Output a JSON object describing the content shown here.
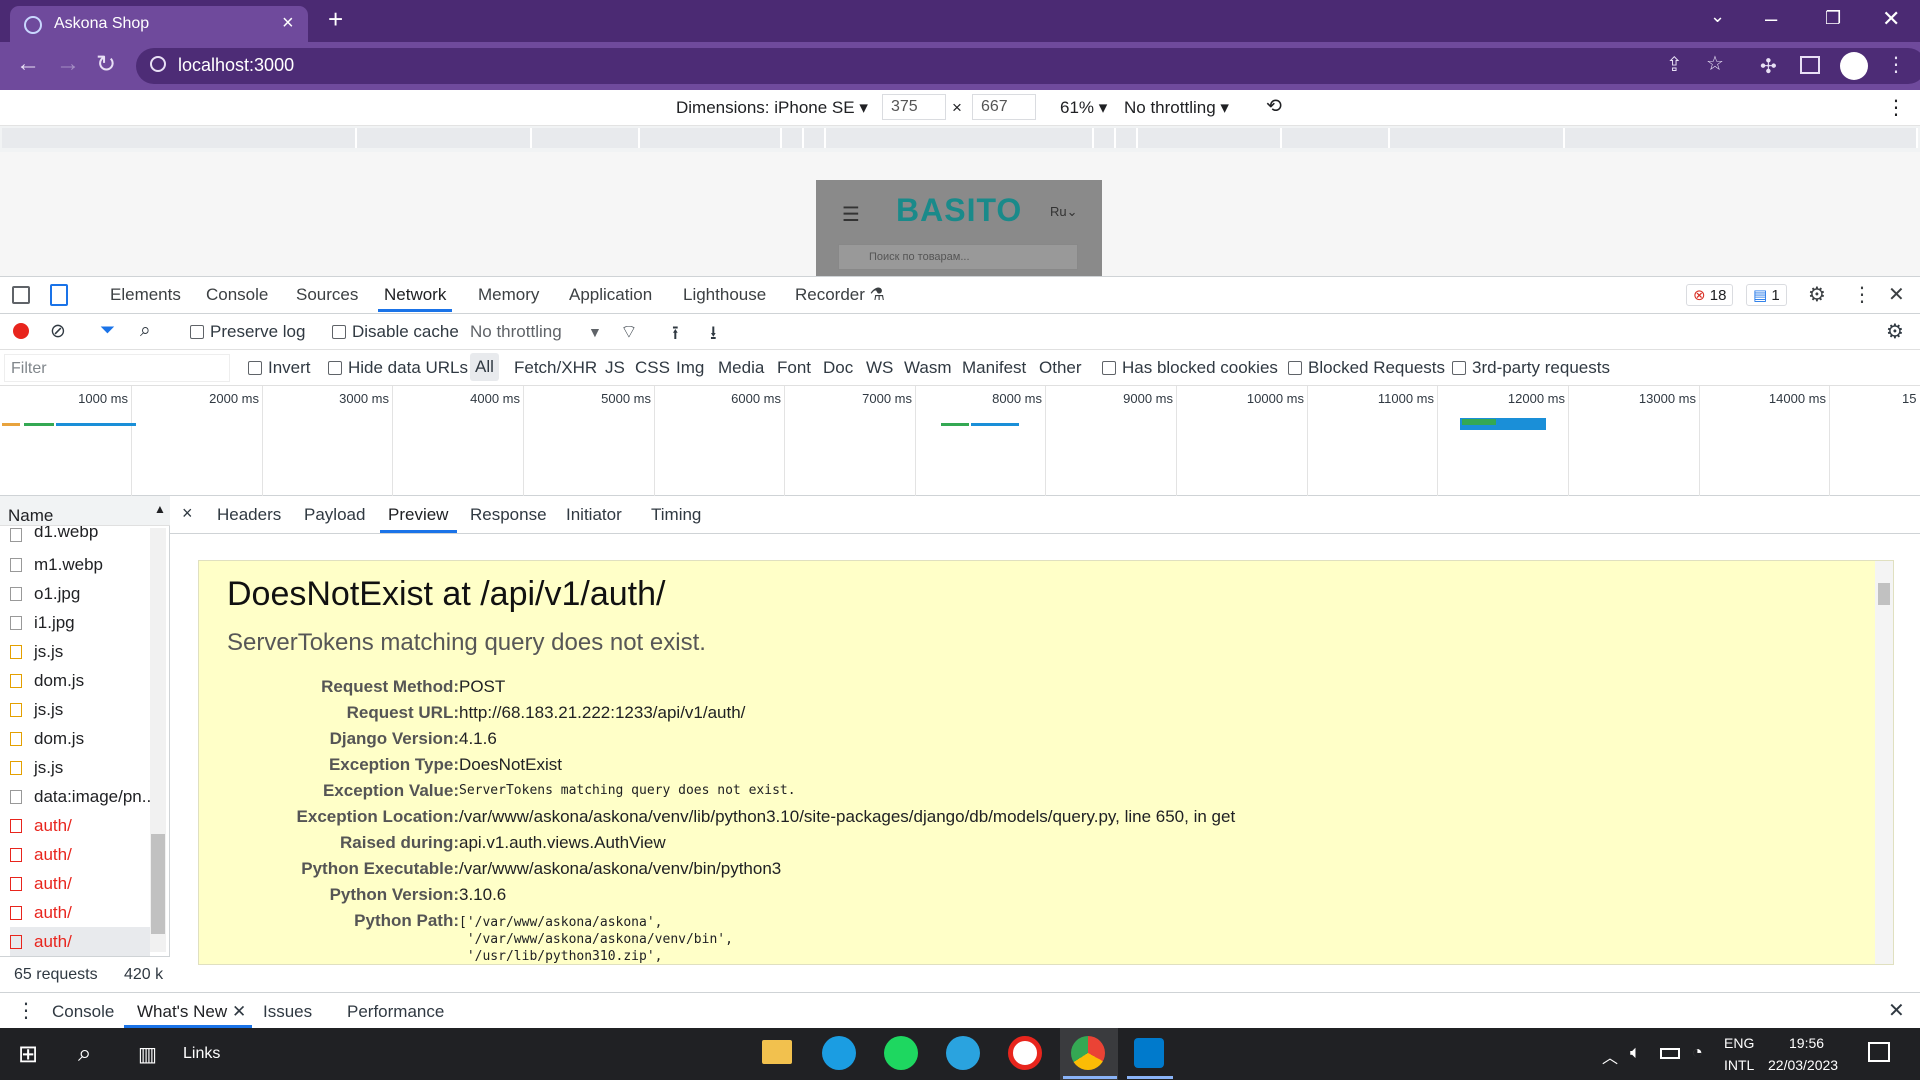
{
  "browser": {
    "tab_title": "Askona Shop",
    "url": "localhost:3000"
  },
  "emulation": {
    "dimensions_label": "Dimensions: iPhone SE",
    "width": "375",
    "height": "667",
    "times": "×",
    "zoom": "61%",
    "throttling": "No throttling"
  },
  "page_preview": {
    "logo": "BASITO",
    "lang": "Ru",
    "search_placeholder": "Поиск по товарам..."
  },
  "devtools": {
    "tabs": [
      "Elements",
      "Console",
      "Sources",
      "Network",
      "Memory",
      "Application",
      "Lighthouse",
      "Recorder"
    ],
    "errors_count": "18",
    "messages_count": "1",
    "toolbar": {
      "preserve_log": "Preserve log",
      "disable_cache": "Disable cache",
      "throttling": "No throttling"
    },
    "filter": {
      "placeholder": "Filter",
      "invert": "Invert",
      "hide_data_urls": "Hide data URLs",
      "types": [
        "All",
        "Fetch/XHR",
        "JS",
        "CSS",
        "Img",
        "Media",
        "Font",
        "Doc",
        "WS",
        "Wasm",
        "Manifest",
        "Other"
      ],
      "has_blocked_cookies": "Has blocked cookies",
      "blocked_requests": "Blocked Requests",
      "third_party": "3rd-party requests"
    },
    "timeline_ticks": [
      "1000 ms",
      "2000 ms",
      "3000 ms",
      "4000 ms",
      "5000 ms",
      "6000 ms",
      "7000 ms",
      "8000 ms",
      "9000 ms",
      "10000 ms",
      "11000 ms",
      "12000 ms",
      "13000 ms",
      "14000 ms",
      "15"
    ],
    "requests_header": "Name",
    "requests": [
      {
        "name": "d1.webp",
        "kind": "img"
      },
      {
        "name": "m1.webp",
        "kind": "img"
      },
      {
        "name": "o1.jpg",
        "kind": "img"
      },
      {
        "name": "i1.jpg",
        "kind": "img"
      },
      {
        "name": "js.js",
        "kind": "js"
      },
      {
        "name": "dom.js",
        "kind": "js"
      },
      {
        "name": "js.js",
        "kind": "js"
      },
      {
        "name": "dom.js",
        "kind": "js"
      },
      {
        "name": "js.js",
        "kind": "js"
      },
      {
        "name": "data:image/pn...",
        "kind": "img"
      },
      {
        "name": "auth/",
        "kind": "err"
      },
      {
        "name": "auth/",
        "kind": "err"
      },
      {
        "name": "auth/",
        "kind": "err"
      },
      {
        "name": "auth/",
        "kind": "err"
      },
      {
        "name": "auth/",
        "kind": "err"
      }
    ],
    "summary_requests": "65 requests",
    "summary_size": "420 k",
    "detail_tabs": [
      "Headers",
      "Payload",
      "Preview",
      "Response",
      "Initiator",
      "Timing"
    ],
    "preview": {
      "title": "DoesNotExist at /api/v1/auth/",
      "subtitle": "ServerTokens matching query does not exist.",
      "rows": [
        {
          "k": "Request Method:",
          "v": "POST"
        },
        {
          "k": "Request URL:",
          "v": "http://68.183.21.222:1233/api/v1/auth/"
        },
        {
          "k": "Django Version:",
          "v": "4.1.6"
        },
        {
          "k": "Exception Type:",
          "v": "DoesNotExist"
        },
        {
          "k": "Exception Value:",
          "v": "ServerTokens matching query does not exist."
        },
        {
          "k": "Exception Location:",
          "v": "/var/www/askona/askona/venv/lib/python3.10/site-packages/django/db/models/query.py, line 650, in get"
        },
        {
          "k": "Raised during:",
          "v": "api.v1.auth.views.AuthView"
        },
        {
          "k": "Python Executable:",
          "v": "/var/www/askona/askona/venv/bin/python3"
        },
        {
          "k": "Python Version:",
          "v": "3.10.6"
        },
        {
          "k": "Python Path:",
          "v": "['/var/www/askona/askona',"
        }
      ],
      "path_more": [
        " '/var/www/askona/askona/venv/bin',",
        " '/usr/lib/python310.zip',"
      ]
    },
    "drawer_tabs": [
      "Console",
      "What's New",
      "Issues",
      "Performance"
    ]
  },
  "taskbar": {
    "links": "Links",
    "lang1": "ENG",
    "lang2": "INTL",
    "time": "19:56",
    "date": "22/03/2023"
  }
}
